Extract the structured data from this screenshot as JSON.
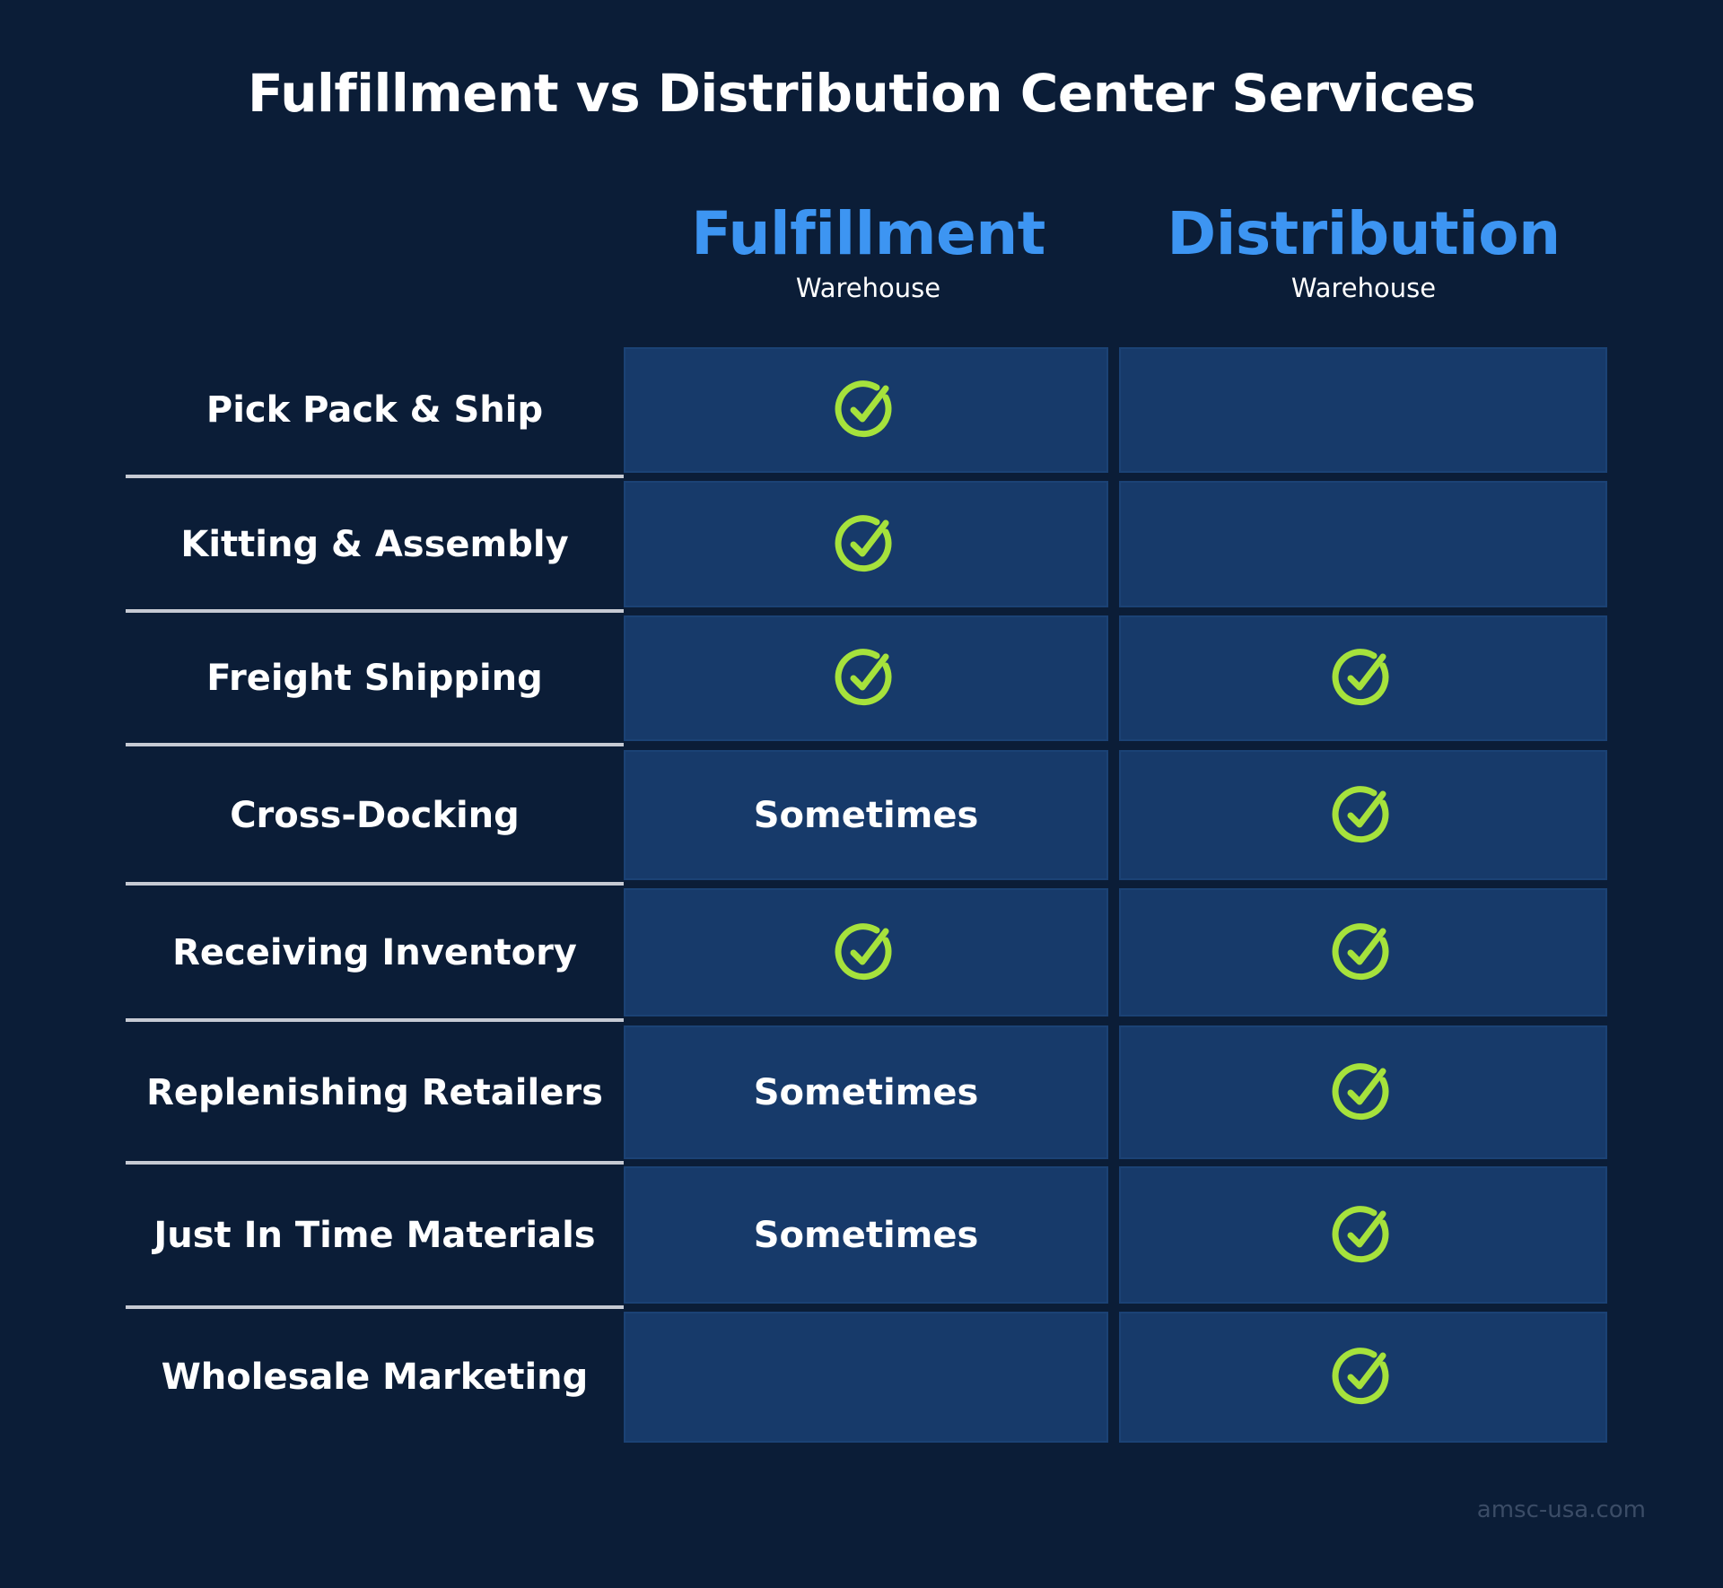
{
  "title": "Fulfillment vs Distribution Center Services",
  "columns": [
    {
      "name": "Fulfillment",
      "subtitle": "Warehouse"
    },
    {
      "name": "Distribution",
      "subtitle": "Warehouse"
    }
  ],
  "colors": {
    "background": "#0b1d37",
    "cell": "#173a6a",
    "header_accent": "#3d95f2",
    "check": "#a6e23c",
    "separator": "#c6cad3"
  },
  "rows": [
    {
      "service": "Pick Pack & Ship",
      "fulfillment": "check",
      "distribution": ""
    },
    {
      "service": "Kitting & Assembly",
      "fulfillment": "check",
      "distribution": ""
    },
    {
      "service": "Freight Shipping",
      "fulfillment": "check",
      "distribution": "check"
    },
    {
      "service": "Cross-Docking",
      "fulfillment": "Sometimes",
      "distribution": "check"
    },
    {
      "service": "Receiving Inventory",
      "fulfillment": "check",
      "distribution": "check"
    },
    {
      "service": "Replenishing Retailers",
      "fulfillment": "Sometimes",
      "distribution": "check"
    },
    {
      "service": "Just In Time Materials",
      "fulfillment": "Sometimes",
      "distribution": "check"
    },
    {
      "service": "Wholesale Marketing",
      "fulfillment": "",
      "distribution": "check"
    }
  ],
  "watermark": "amsc-usa.com"
}
